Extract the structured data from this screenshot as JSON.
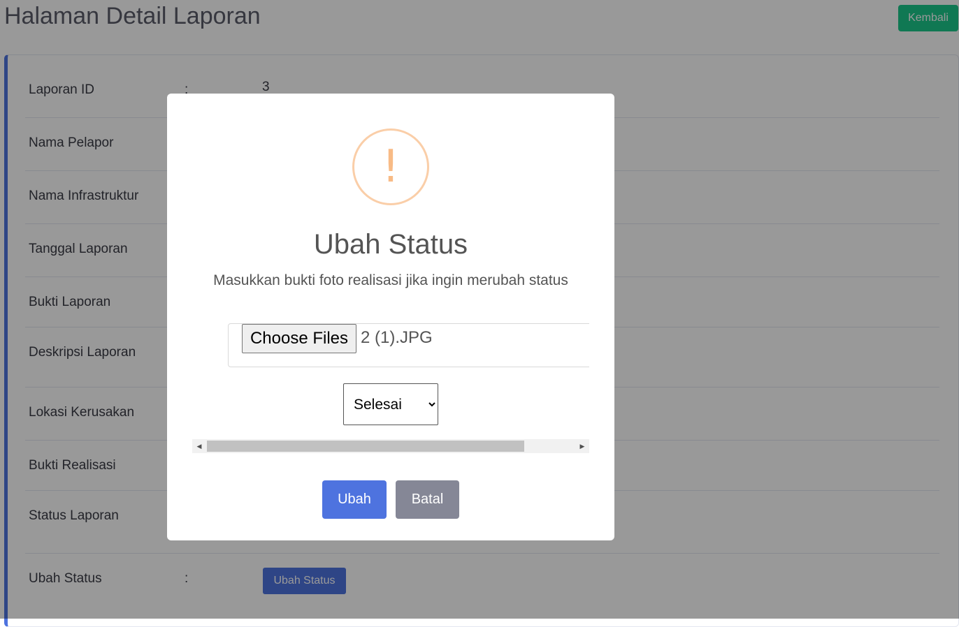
{
  "header": {
    "title": "Halaman Detail Laporan",
    "back_label": "Kembali"
  },
  "details": {
    "rows": [
      {
        "label": "Laporan ID",
        "colon": ":",
        "value": "3"
      },
      {
        "label": "Nama Pelapor"
      },
      {
        "label": "Nama Infrastruktur"
      },
      {
        "label": "Tanggal Laporan"
      },
      {
        "label": "Bukti Laporan"
      },
      {
        "label": "Deskripsi Laporan"
      },
      {
        "label": "Lokasi Kerusakan"
      },
      {
        "label": "Bukti Realisasi"
      },
      {
        "label": "Status Laporan"
      },
      {
        "label": "Ubah Status",
        "colon": ":",
        "button_label": "Ubah Status"
      }
    ]
  },
  "modal": {
    "icon_glyph": "!",
    "icon": "warning-icon",
    "title": "Ubah Status",
    "text": "Masukkan bukti foto realisasi jika ingin merubah status",
    "file": {
      "button_label": "Choose Files",
      "file_name": "2 (1).JPG"
    },
    "status_select": {
      "selected": "Selesai",
      "options": [
        "Selesai"
      ]
    },
    "confirm_label": "Ubah",
    "cancel_label": "Batal"
  },
  "colors": {
    "primary": "#4e73df",
    "success": "#1cc88a",
    "secondary": "#858796",
    "warning_icon": "#f8bb86"
  }
}
